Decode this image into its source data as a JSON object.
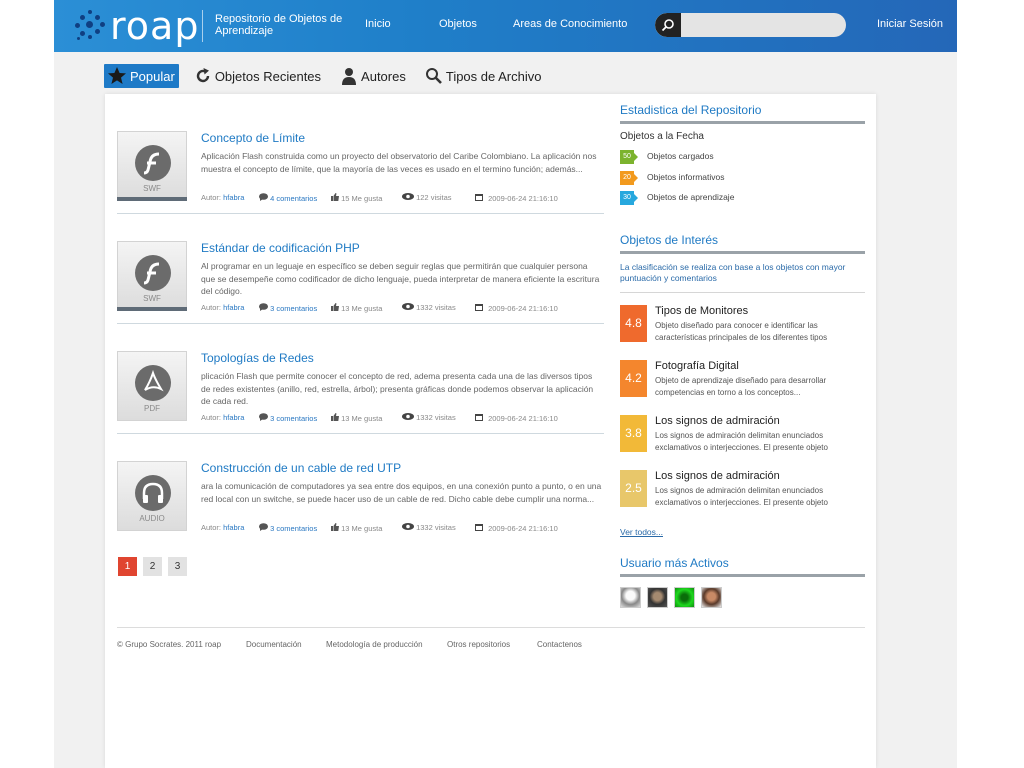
{
  "header": {
    "logo_text": "roap",
    "tagline": "Repositorio de Objetos de Aprendizaje",
    "nav": [
      "Inicio",
      "Objetos",
      "Areas de Conocimiento"
    ],
    "search_placeholder": "",
    "login": "Iniciar Sesión"
  },
  "tabs": [
    {
      "label": "Popular",
      "icon": "star-icon",
      "active": true
    },
    {
      "label": "Objetos Recientes",
      "icon": "refresh-icon"
    },
    {
      "label": "Autores",
      "icon": "user-icon"
    },
    {
      "label": "Tipos de Archivo",
      "icon": "search-icon"
    }
  ],
  "items": [
    {
      "title": "Concepto de Límite",
      "description": "Aplicación Flash construida como un proyecto del observatorio del Caribe Colombiano. La aplicación nos muestra el concepto de límite, que la mayoría de las veces es usado en el termino función; además...",
      "type": "SWF",
      "icon": "flash-icon",
      "author_label": "Autor:",
      "author": "hfabra",
      "comments": "4 comentarios",
      "likes": "15 Me gusta",
      "visits": "122 visitas",
      "date": "2009-06-24 21:16:10"
    },
    {
      "title": "Estándar de codificación PHP",
      "description": "Al programar en un leguaje en específico se deben seguir reglas que permitirán que cualquier persona que se desempeñe como codificador de dicho lenguaje, pueda interpretar de manera eficiente la escritura del código.",
      "type": "SWF",
      "icon": "flash-icon",
      "author_label": "Autor:",
      "author": "hfabra",
      "comments": "3 comentarios",
      "likes": "13 Me gusta",
      "visits": "1332 visitas",
      "date": "2009-06-24 21:16:10"
    },
    {
      "title": "Topologías de Redes",
      "description": "plicación Flash que permite conocer el concepto de red, adema presenta cada una de las diversos tipos de redes existentes (anillo, red, estrella, árbol); presenta gráficas donde podemos observar la aplicación de cada red.",
      "type": "PDF",
      "icon": "pdf-icon",
      "author_label": "Autor:",
      "author": "hfabra",
      "comments": "3 comentarios",
      "likes": "13 Me gusta",
      "visits": "1332 visitas",
      "date": "2009-06-24 21:16:10"
    },
    {
      "title": "Construcción de un cable de red UTP",
      "description": "ara la comunicación de computadores ya sea entre dos equipos, en una conexión punto a punto, o en una red local con un switche, se puede hacer uso de un cable de red. Dicho cable debe cumplir una norma...",
      "type": "AUDIO",
      "icon": "headphones-icon",
      "author_label": "Autor:",
      "author": "hfabra",
      "comments": "3 comentarios",
      "likes": "13 Me gusta",
      "visits": "1332 visitas",
      "date": "2009-06-24 21:16:10"
    }
  ],
  "pagination": [
    "1",
    "2",
    "3"
  ],
  "sidebar": {
    "stats_title": "Estadistica del Repositorio",
    "stats_sub": "Objetos a la Fecha",
    "stats": [
      {
        "count": "50",
        "label": "Objetos cargados",
        "color": "#7cb32e"
      },
      {
        "count": "20",
        "label": "Objetos informativos",
        "color": "#f29a1e"
      },
      {
        "count": "30",
        "label": "Objetos de aprendizaje",
        "color": "#27a8de"
      }
    ],
    "interest_title": "Objetos de Interés",
    "interest_note": "La clasificación se realiza con base a los objetos con mayor puntuación y comentarios",
    "rated": [
      {
        "score": "4.8",
        "title": "Tipos de Monitores",
        "desc": "Objeto diseñado para conocer e identificar las características principales de los diferentes tipos",
        "color": "#ef6a2d"
      },
      {
        "score": "4.2",
        "title": "Fotografía Digital",
        "desc": "Objeto de aprendizaje diseñado para desarrollar competencias en torno a los conceptos...",
        "color": "#f4862d"
      },
      {
        "score": "3.8",
        "title": "Los signos de admiración",
        "desc": "Los signos de admiración delimitan enunciados exclamativos o interjecciones. El presente objeto",
        "color": "#f2b938"
      },
      {
        "score": "2.5",
        "title": "Los signos de admiración",
        "desc": "Los signos de admiración delimitan enunciados exclamativos o interjecciones. El presente objeto",
        "color": "#e8c76a"
      }
    ],
    "see_all": "Ver todos...",
    "active_users_title": "Usuario más Activos"
  },
  "footer": {
    "copyright": "© Grupo Socrates. 2011 roap",
    "links": [
      "Documentación",
      "Metodología de producción",
      "Otros repositorios",
      "Contactenos"
    ]
  }
}
